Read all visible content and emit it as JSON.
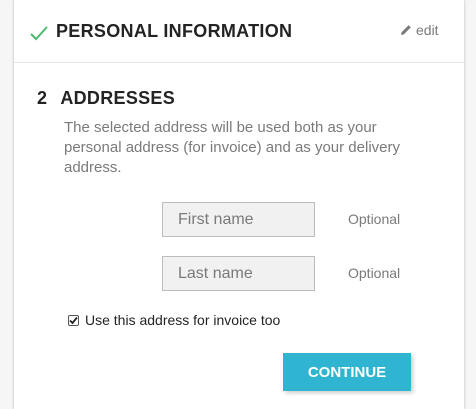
{
  "personal_step": {
    "title": "PERSONAL INFORMATION",
    "edit_label": "edit",
    "status_icon": "check-icon",
    "accent_color": "#4cbb6c"
  },
  "addresses_step": {
    "number": "2",
    "title": "ADDRESSES",
    "description": "The selected address will be used both as your personal address (for invoice) and as your delivery address."
  },
  "form": {
    "first_name": {
      "value": "",
      "placeholder": "First name",
      "hint": "Optional"
    },
    "last_name": {
      "value": "",
      "placeholder": "Last name",
      "hint": "Optional"
    },
    "invoice_checkbox": {
      "label": "Use this address for invoice too",
      "checked": true
    }
  },
  "continue_button": {
    "label": "CONTINUE",
    "color": "#2fb5d2"
  }
}
